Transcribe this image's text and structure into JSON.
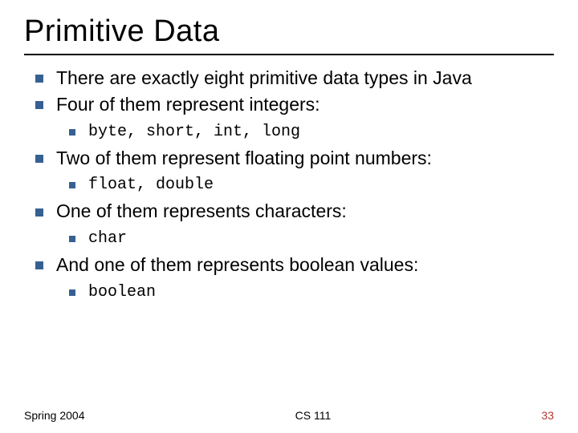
{
  "title": "Primitive Data",
  "items": {
    "a": "There are exactly eight primitive data types in Java",
    "b": "Four of them represent integers:",
    "b1": "byte, short, int, long",
    "c": "Two of them represent floating point numbers:",
    "c1": "float, double",
    "d": "One of them represents characters:",
    "d1": "char",
    "e": "And one of them represents boolean values:",
    "e1": "boolean"
  },
  "footer": {
    "left": "Spring 2004",
    "center": "CS 111",
    "right": "33"
  }
}
